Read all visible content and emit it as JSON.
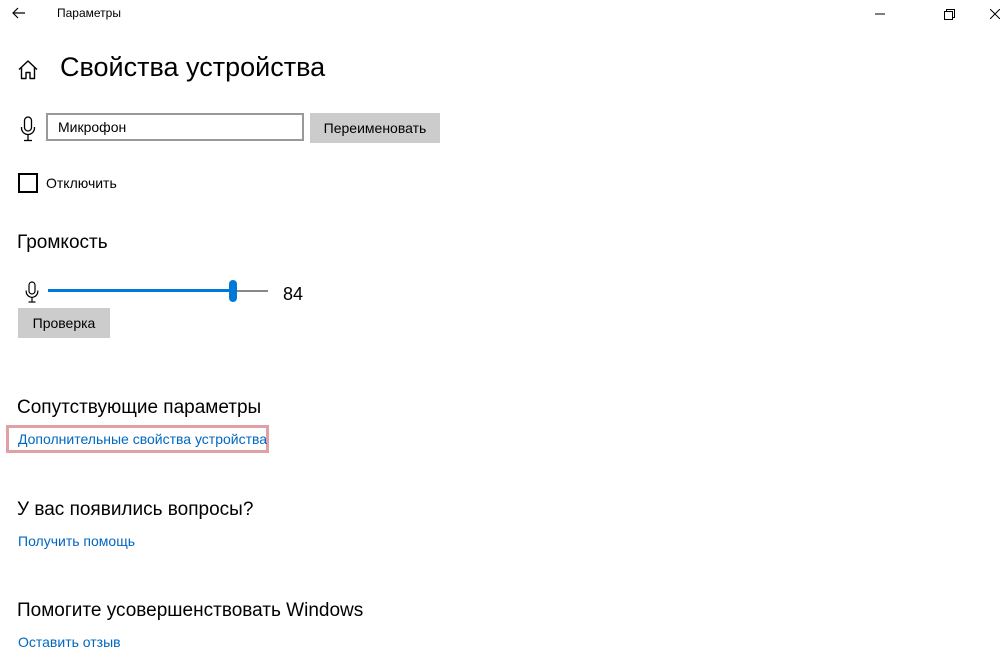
{
  "window": {
    "title": "Параметры"
  },
  "page": {
    "title": "Свойства устройства"
  },
  "device": {
    "name_value": "Микрофон",
    "rename_label": "Переименовать",
    "disable_label": "Отключить",
    "disabled": false
  },
  "volume": {
    "heading": "Громкость",
    "value": "84",
    "level": 84,
    "test_label": "Проверка"
  },
  "related": {
    "heading": "Сопутствующие параметры",
    "advanced_link": "Дополнительные свойства устройства"
  },
  "questions": {
    "heading": "У вас появились вопросы?",
    "help_link": "Получить помощь"
  },
  "improve": {
    "heading": "Помогите усовершенствовать Windows",
    "feedback_link": "Оставить отзыв"
  },
  "colors": {
    "accent": "#0078d7",
    "link": "#0067c0",
    "button_bg": "#cccccc",
    "highlight_border": "#e0a0a6"
  },
  "icons": {
    "back": "arrow-left-icon",
    "minimize": "minimize-icon",
    "restore": "restore-icon",
    "close": "close-icon",
    "home": "home-icon",
    "microphone": "microphone-icon"
  }
}
